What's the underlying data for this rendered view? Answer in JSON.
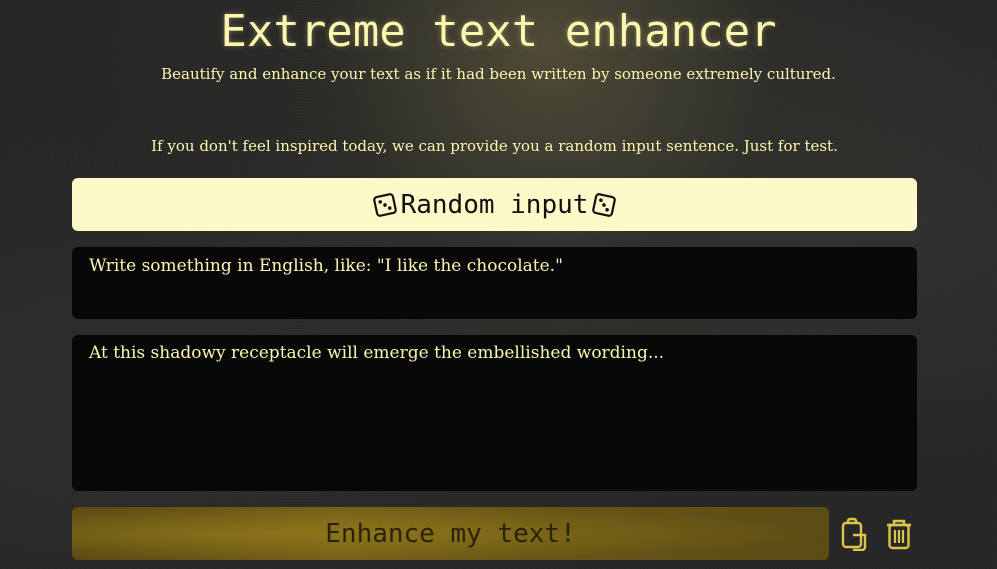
{
  "header": {
    "title": "Extreme text enhancer",
    "subtitle": "Beautify and enhance your text as if it had been written by someone extremely cultured."
  },
  "random": {
    "hint": "If you don't feel inspired today, we can provide you a random input sentence. Just for test.",
    "button_label": "Random input",
    "icon": "dice-icon"
  },
  "input": {
    "placeholder": "Write something in English, like: \"I like the chocolate.\"",
    "value": ""
  },
  "output": {
    "placeholder": "At this shadowy receptacle will emerge the embellished wording...",
    "value": ""
  },
  "actions": {
    "enhance_label": "Enhance my text!",
    "copy_icon": "copy-icon",
    "trash_icon": "trash-icon"
  },
  "colors": {
    "accent": "#fdf6b0",
    "button_bg": "#fef9c9",
    "panel_bg": "#080808",
    "enhance_bg": "#6b5816"
  }
}
